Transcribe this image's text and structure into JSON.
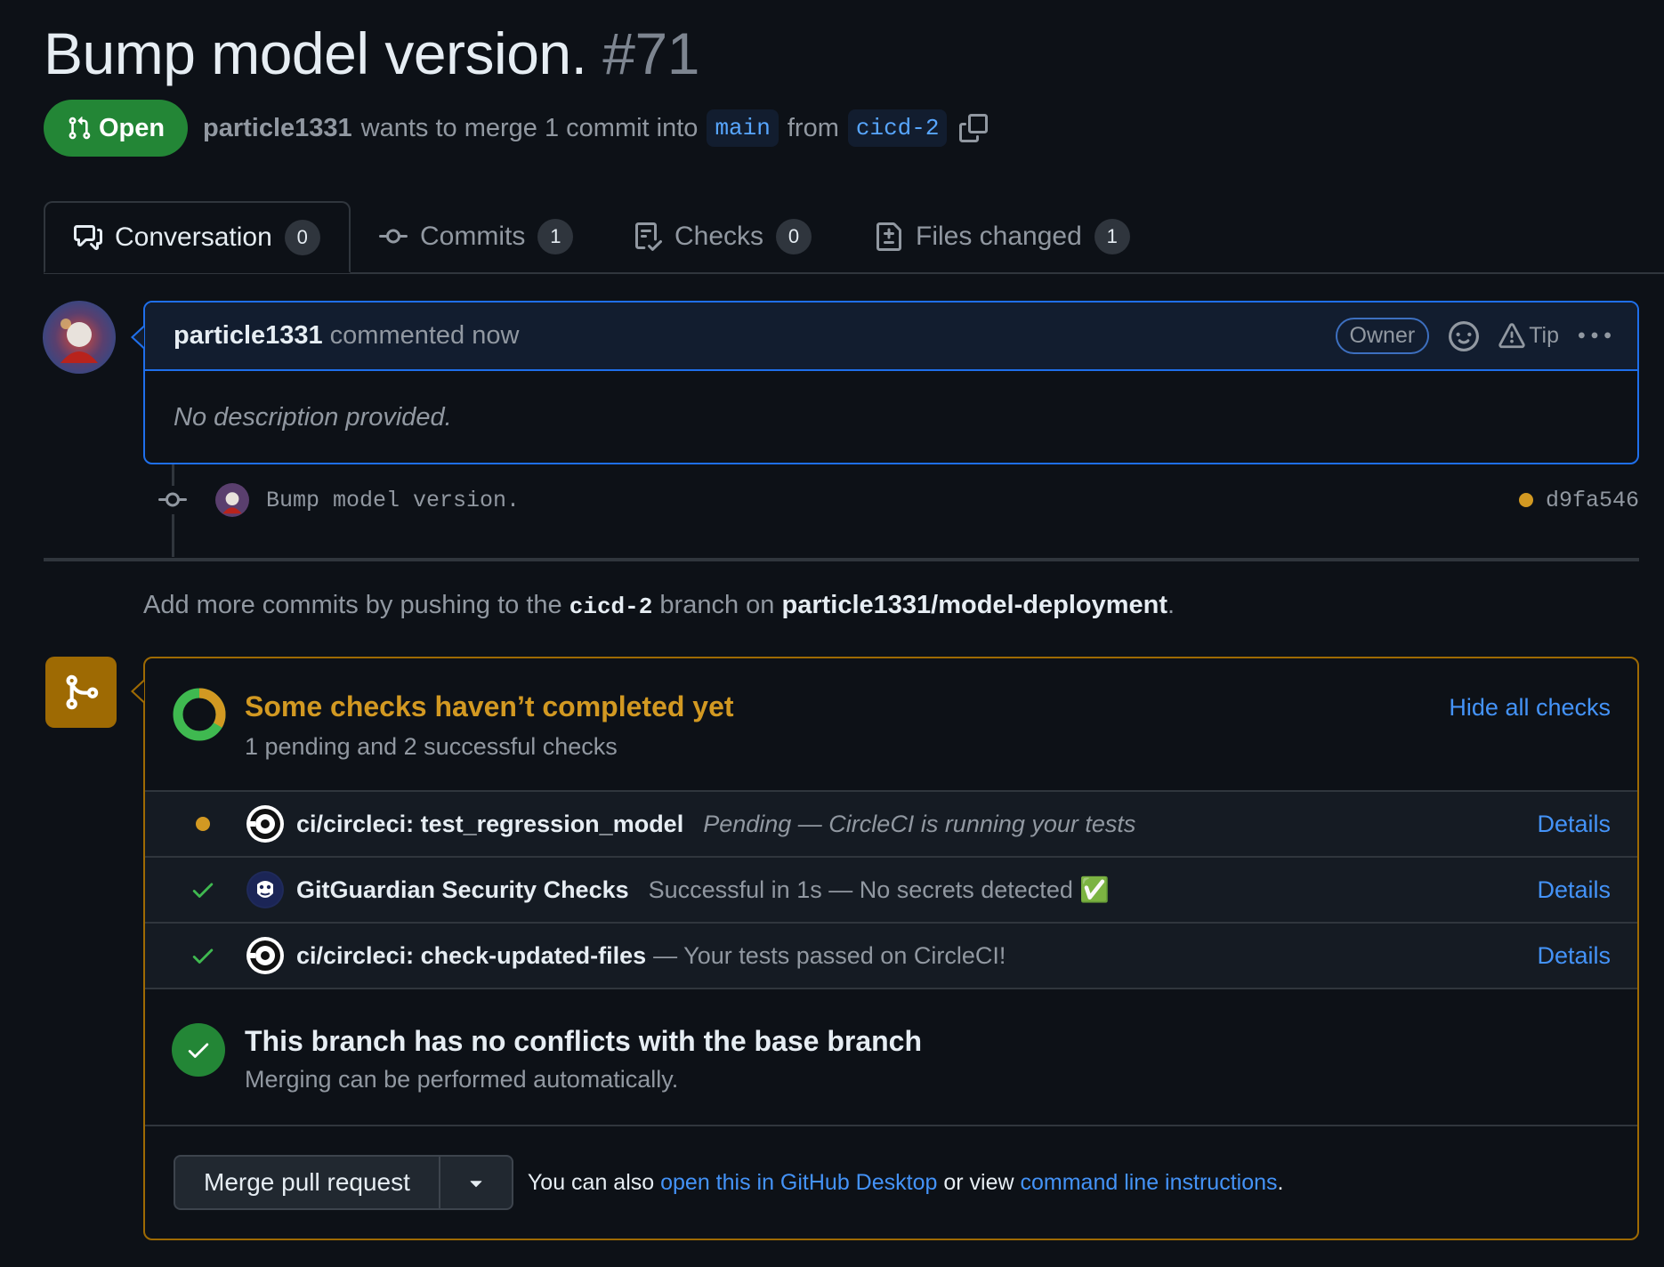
{
  "pr": {
    "title": "Bump model version.",
    "number": "#71",
    "state": "Open",
    "author": "particle1331",
    "merge_text": "wants to merge 1 commit into",
    "base_branch": "main",
    "from_text": "from",
    "head_branch": "cicd-2"
  },
  "tabs": [
    {
      "label": "Conversation",
      "count": "0",
      "icon": "comment-discussion-icon"
    },
    {
      "label": "Commits",
      "count": "1",
      "icon": "git-commit-icon"
    },
    {
      "label": "Checks",
      "count": "0",
      "icon": "checklist-icon"
    },
    {
      "label": "Files changed",
      "count": "1",
      "icon": "file-diff-icon"
    }
  ],
  "comment": {
    "author": "particle1331",
    "when": "commented now",
    "role": "Owner",
    "tip": "Tip",
    "body": "No description provided."
  },
  "commit": {
    "message": "Bump model version.",
    "hash": "d9fa546"
  },
  "push_hint": {
    "prefix": "Add more commits by pushing to the",
    "branch": "cicd-2",
    "middle": "branch on",
    "repo": "particle1331/model-deployment",
    "suffix": "."
  },
  "checks_summary": {
    "title": "Some checks haven’t completed yet",
    "subtitle": "1 pending and 2 successful checks",
    "hide_link": "Hide all checks"
  },
  "checks": [
    {
      "name": "ci/circleci: test_regression_model",
      "desc": "Pending — CircleCI is running your tests",
      "status": "pending",
      "details": "Details"
    },
    {
      "name": "GitGuardian Security Checks",
      "desc": "Successful in 1s — No secrets detected ✅",
      "status": "success",
      "details": "Details"
    },
    {
      "name": "ci/circleci: check-updated-files",
      "desc": "— Your tests passed on CircleCI!",
      "status": "success",
      "details": "Details"
    }
  ],
  "conflicts": {
    "title": "This branch has no conflicts with the base branch",
    "subtitle": "Merging can be performed automatically."
  },
  "merge": {
    "button": "Merge pull request",
    "text_prefix": "You can also",
    "link1": "open this in GitHub Desktop",
    "text_middle": "or view",
    "link2": "command line instructions",
    "text_suffix": "."
  },
  "colors": {
    "background": "#0d1117",
    "open_green": "#238636",
    "pending_yellow": "#d29922",
    "link_blue": "#4493f8",
    "comment_border": "#1f6feb"
  }
}
